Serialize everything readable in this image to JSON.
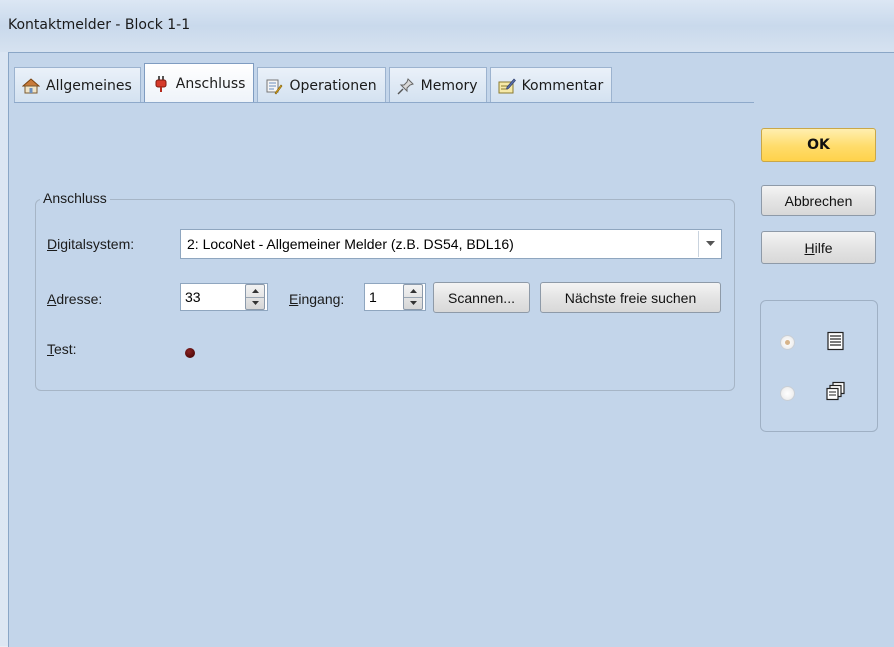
{
  "window": {
    "title": "Kontaktmelder - Block 1-1"
  },
  "tabs": [
    {
      "label": "Allgemeines",
      "icon": "house-icon",
      "active": false
    },
    {
      "label": "Anschluss",
      "icon": "plug-icon",
      "active": true
    },
    {
      "label": "Operationen",
      "icon": "operations-icon",
      "active": false
    },
    {
      "label": "Memory",
      "icon": "pin-icon",
      "active": false
    },
    {
      "label": "Kommentar",
      "icon": "note-icon",
      "active": false
    }
  ],
  "anschluss": {
    "group_title": "Anschluss",
    "digitalsystem_label_first": "D",
    "digitalsystem_label_rest": "igitalsystem:",
    "digitalsystem_value": "2: LocoNet - Allgemeiner Melder (z.B. DS54, BDL16)",
    "adresse_label_first": "A",
    "adresse_label_rest": "dresse:",
    "adresse_value": "33",
    "eingang_label_first": "E",
    "eingang_label_rest": "ingang:",
    "eingang_value": "1",
    "scannen_label": "Scannen...",
    "naechste_label": "Nächste freie suchen",
    "test_label_first": "T",
    "test_label_rest": "est:"
  },
  "buttons": {
    "ok": "OK",
    "abbrechen": "Abbrechen",
    "hilfe_first": "H",
    "hilfe_rest": "ilfe"
  },
  "view_options": [
    {
      "icon": "list-icon",
      "selected": true
    },
    {
      "icon": "cascade-icon",
      "selected": false
    }
  ],
  "colors": {
    "ok_button": "#ffd24b",
    "led": "#5a0a0a"
  }
}
